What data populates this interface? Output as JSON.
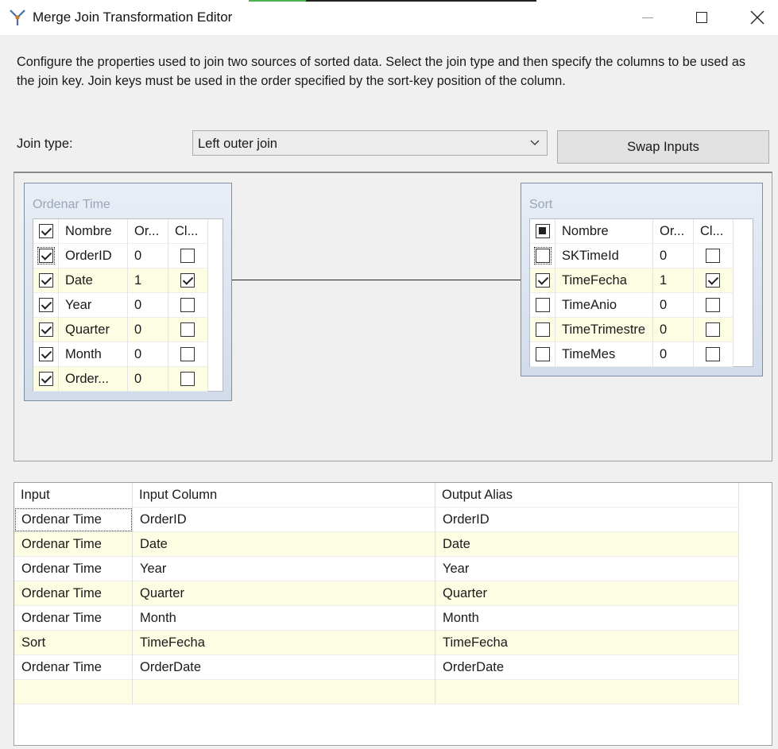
{
  "window": {
    "title": "Merge Join Transformation Editor"
  },
  "description": "Configure the properties used to join two sources of sorted data. Select the join type and then specify the columns to be used as the join key. Join keys must be used in the order specified by the sort-key position of the column.",
  "join_type": {
    "label": "Join type:",
    "selected": "Left outer join"
  },
  "swap_button": "Swap Inputs",
  "left_table": {
    "title": "Ordenar Time",
    "headers": [
      "Nombre",
      "Or...",
      "Cl..."
    ],
    "rows": [
      {
        "name": "OrderID",
        "order": "0",
        "selected": true,
        "key": false
      },
      {
        "name": "Date",
        "order": "1",
        "selected": true,
        "key": true
      },
      {
        "name": "Year",
        "order": "0",
        "selected": true,
        "key": false
      },
      {
        "name": "Quarter",
        "order": "0",
        "selected": true,
        "key": false
      },
      {
        "name": "Month",
        "order": "0",
        "selected": true,
        "key": false
      },
      {
        "name": "Order...",
        "order": "0",
        "selected": true,
        "key": false
      }
    ]
  },
  "right_table": {
    "title": "Sort",
    "headers": [
      "Nombre",
      "Or...",
      "Cl..."
    ],
    "rows": [
      {
        "name": "SKTimeId",
        "order": "0",
        "selected": false,
        "key": false
      },
      {
        "name": "TimeFecha",
        "order": "1",
        "selected": true,
        "key": true
      },
      {
        "name": "TimeAnio",
        "order": "0",
        "selected": false,
        "key": false
      },
      {
        "name": "TimeTrimestre",
        "order": "0",
        "selected": false,
        "key": false
      },
      {
        "name": "TimeMes",
        "order": "0",
        "selected": false,
        "key": false
      }
    ]
  },
  "output_grid": {
    "headers": [
      "Input",
      "Input Column",
      "Output Alias"
    ],
    "rows": [
      [
        "Ordenar Time",
        "OrderID",
        "OrderID"
      ],
      [
        "Ordenar Time",
        "Date",
        "Date"
      ],
      [
        "Ordenar Time",
        "Year",
        "Year"
      ],
      [
        "Ordenar Time",
        "Quarter",
        "Quarter"
      ],
      [
        "Ordenar Time",
        "Month",
        "Month"
      ],
      [
        "Sort",
        "TimeFecha",
        "TimeFecha"
      ],
      [
        "Ordenar Time",
        "OrderDate",
        "OrderDate"
      ],
      [
        "",
        "",
        ""
      ]
    ]
  }
}
